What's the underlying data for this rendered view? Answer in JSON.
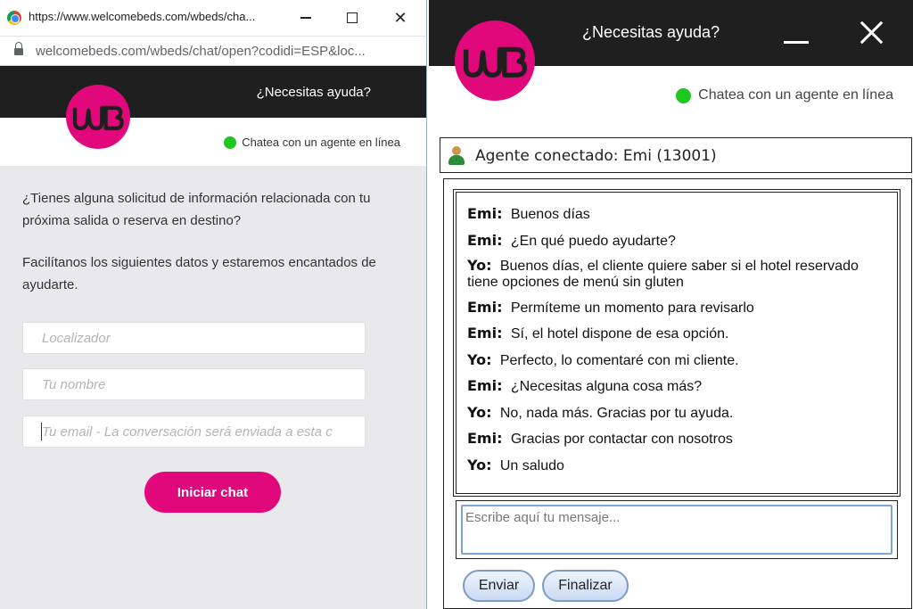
{
  "left_window": {
    "title_url": "https://www.welcomebeds.com/wbeds/cha...",
    "address": "welcomebeds.com/wbeds/chat/open?codidi=ESP&loc...",
    "header_title": "¿Necesitas ayuda?",
    "status": "Chatea con un agente en línea",
    "intro_1": "¿Tienes alguna solicitud de información relacionada con tu próxima salida o reserva en destino?",
    "intro_2": "Facilítanos los siguientes datos y estaremos encantados de ayudarte.",
    "fields": {
      "locator_placeholder": "Localizador",
      "name_placeholder": "Tu nombre",
      "email_placeholder": "Tu email - La conversación será enviada a esta c"
    },
    "start_button": "Iniciar chat"
  },
  "right_window": {
    "header_title": "¿Necesitas ayuda?",
    "status": "Chatea con un agente en línea",
    "agent_line": "Agente conectado: Emi (13001)",
    "messages": [
      {
        "who": "Emi:",
        "text": "Buenos días"
      },
      {
        "who": "Emi:",
        "text": "¿En qué puedo ayudarte?"
      },
      {
        "who": "Yo:",
        "text": "Buenos días, el cliente quiere saber si el hotel reservado tiene opciones de menú sin gluten"
      },
      {
        "who": "Emi:",
        "text": "Permíteme un momento para revisarlo"
      },
      {
        "who": "Emi:",
        "text": "Sí, el hotel dispone de esa opción."
      },
      {
        "who": "Yo:",
        "text": "Perfecto, lo comentaré con mi cliente."
      },
      {
        "who": "Emi:",
        "text": "¿Necesitas alguna cosa más?"
      },
      {
        "who": "Yo:",
        "text": "No, nada más. Gracias por tu ayuda."
      },
      {
        "who": "Emi:",
        "text": "Gracias por contactar con nosotros"
      },
      {
        "who": "Yo:",
        "text": "Un saludo"
      }
    ],
    "input_placeholder": "Escribe aquí tu mensaje...",
    "send_button": "Enviar",
    "finish_button": "Finalizar"
  },
  "colors": {
    "brand_pink": "#e0087a",
    "header_dark": "#1f1f1f",
    "online_green": "#1fc61f",
    "button_blue_border": "#7e9bc8"
  },
  "icons": {
    "logo": "wb-logo-icon",
    "online": "online-dot-icon",
    "agent": "agent-user-icon",
    "lock": "lock-icon"
  }
}
